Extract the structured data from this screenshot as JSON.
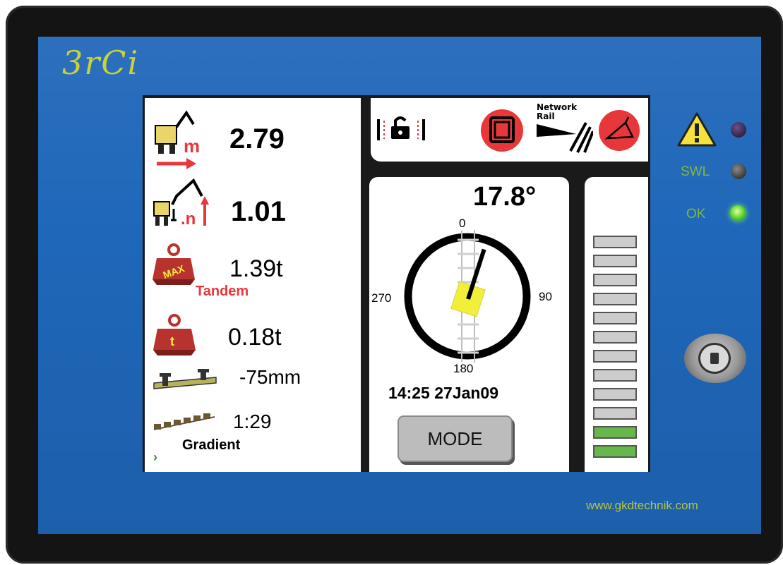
{
  "device": {
    "logo_text": "3rCi",
    "website": "www.gkdtechnik.com"
  },
  "readings": {
    "radius_value": "2.79",
    "height_value": "1.01",
    "max_load_value": "1.39t",
    "max_load_label": "Tandem",
    "load_value": "0.18t",
    "cant_value": "-75mm",
    "gradient_value": "1:29",
    "gradient_label": "Gradient"
  },
  "slew": {
    "angle": "17.8°",
    "ticks": {
      "top": "0",
      "right": "90",
      "bottom": "180",
      "left": "270"
    },
    "slew_angle_deg": 17.8
  },
  "datetime": "14:25 27Jan09",
  "mode_button": {
    "label": "MODE"
  },
  "network_rail": {
    "line1": "Network",
    "line2": "Rail"
  },
  "load_bars": {
    "total": 12,
    "lit": 2
  },
  "indicators": {
    "swl_label": "SWL",
    "ok_label": "OK"
  },
  "colors": {
    "panel_blue": "#1f67b9",
    "alert_red": "#e8373b",
    "bar_green": "#66b84a",
    "logo_green": "#c8d23a",
    "marker_yellow": "#f2ef3a"
  }
}
